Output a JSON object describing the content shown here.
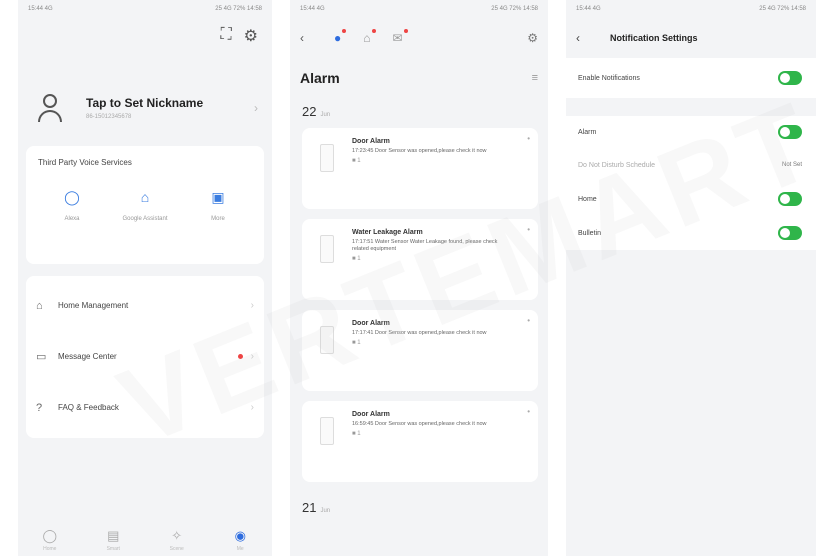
{
  "phone1": {
    "status_left": "15:44 4G",
    "status_right": "25 4G 72% 14:58",
    "top_icons": [
      "scan-icon",
      "gear-icon"
    ],
    "profile": {
      "nickname": "Tap to Set Nickname",
      "account": "86-15012345678"
    },
    "voice": {
      "title": "Third Party Voice Services",
      "items": [
        {
          "icon": "alexa-icon",
          "label": "Alexa"
        },
        {
          "icon": "google-assistant-icon",
          "label": "Google Assistant"
        },
        {
          "icon": "more-icon",
          "label": "More"
        }
      ]
    },
    "menu": [
      {
        "icon": "home-icon",
        "label": "Home Management",
        "dot": false
      },
      {
        "icon": "message-icon",
        "label": "Message Center",
        "dot": true
      },
      {
        "icon": "help-icon",
        "label": "FAQ & Feedback",
        "dot": false
      }
    ],
    "tabs": [
      {
        "icon": "home-icon",
        "label": "Home"
      },
      {
        "icon": "smart-icon",
        "label": "Smart"
      },
      {
        "icon": "scene-icon",
        "label": "Scene"
      },
      {
        "icon": "me-icon",
        "label": "Me"
      }
    ]
  },
  "phone2": {
    "status_left": "15:44 4G",
    "status_right": "25 4G 72% 14:58",
    "title": "Alarm",
    "date1": "22",
    "date1_month": "Jun",
    "alarms": [
      {
        "title": "Door Alarm",
        "desc": "17:23:45 Door Sensor was opened,please check it now",
        "meta": "1"
      },
      {
        "title": "Water Leakage Alarm",
        "desc": "17:17:51 Water Sensor Water Leakage found, please check related equipment",
        "meta": "1"
      },
      {
        "title": "Door Alarm",
        "desc": "17:17:41 Door Sensor was opened,please check it now",
        "meta": "1"
      },
      {
        "title": "Door Alarm",
        "desc": "16:59:45 Door Sensor was opened,please check it now",
        "meta": "1"
      }
    ],
    "date2": "21",
    "date2_month": "Jun"
  },
  "phone3": {
    "status_left": "15:44 4G",
    "status_right": "25 4G 72% 14:58",
    "title": "Notification Settings",
    "settings": {
      "enable": "Enable Notifications",
      "alarm": "Alarm",
      "do_not_disturb": "Do Not Disturb Schedule",
      "dnd_value": "Not Set",
      "home": "Home",
      "bulletin": "Bulletin"
    },
    "toggle_color": "#2fb54a"
  },
  "watermark": "VERTEMART"
}
